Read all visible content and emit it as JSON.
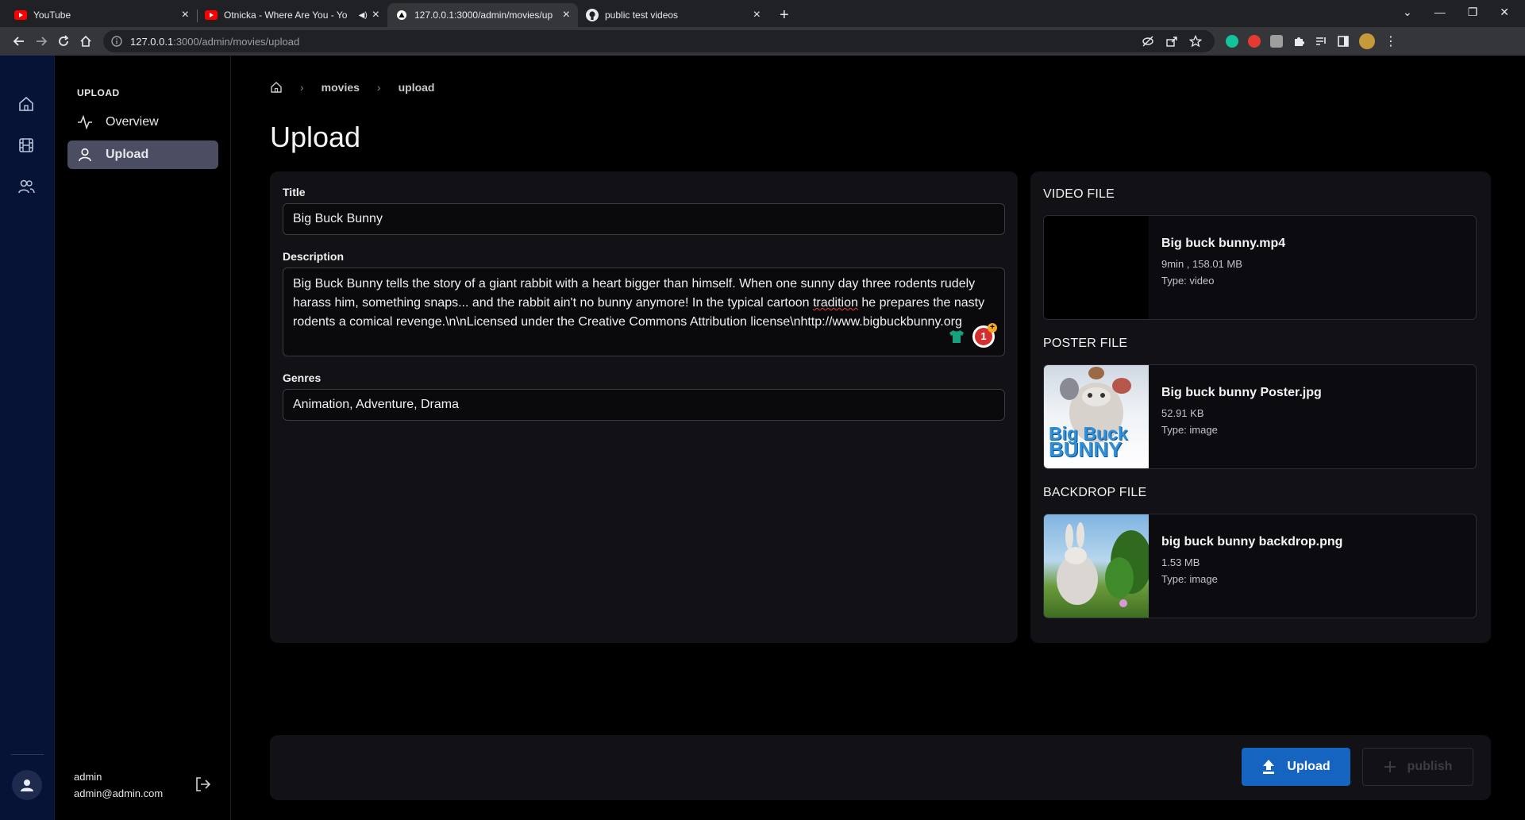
{
  "browser": {
    "tabs": [
      {
        "title": "YouTube",
        "favicon": "youtube-icon",
        "active": false
      },
      {
        "title": "Otnicka - Where Are You - Yo",
        "favicon": "youtube-icon",
        "active": false
      },
      {
        "title": "127.0.0.1:3000/admin/movies/up",
        "favicon": "vercel-triangle-icon",
        "active": true
      },
      {
        "title": "public test videos",
        "favicon": "github-icon",
        "active": false
      }
    ],
    "url_host": "127.0.0.1",
    "url_path": ":3000/admin/movies/upload"
  },
  "subnav": {
    "heading": "UPLOAD",
    "items": [
      {
        "label": "Overview",
        "icon": "activity-icon",
        "active": false
      },
      {
        "label": "Upload",
        "icon": "user-icon",
        "active": true
      }
    ]
  },
  "user": {
    "name": "admin",
    "email": "admin@admin.com"
  },
  "breadcrumb": {
    "items": [
      "movies",
      "upload"
    ]
  },
  "page": {
    "title": "Upload"
  },
  "form": {
    "title_label": "Title",
    "title_value": "Big Buck Bunny",
    "description_label": "Description",
    "description_before": "Big Buck Bunny tells the story of a giant rabbit with a heart bigger than himself. When one sunny day three rodents rudely harass him, something snaps... and the rabbit ain't no bunny anymore! In the typical cartoon ",
    "description_flagged": "tradition",
    "description_after": " he prepares the nasty rodents a comical revenge.\\n\\nLicensed under the Creative Commons Attribution license\\nhttp://www.bigbuckbunny.org",
    "grammar_count": "1",
    "genres_label": "Genres",
    "genres_value": "Animation, Adventure, Drama"
  },
  "files": {
    "video": {
      "section": "VIDEO FILE",
      "name": "Big buck bunny.mp4",
      "size": "9min , 158.01 MB",
      "type": "Type: video"
    },
    "poster": {
      "section": "POSTER FILE",
      "name": "Big buck bunny Poster.jpg",
      "size": "52.91 KB",
      "type": "Type: image",
      "thumb_text_1": "Big Buck",
      "thumb_text_2": "BUNNY"
    },
    "backdrop": {
      "section": "BACKDROP FILE",
      "name": "big buck bunny backdrop.png",
      "size": "1.53 MB",
      "type": "Type: image"
    }
  },
  "actions": {
    "upload_label": "Upload",
    "publish_label": "publish"
  },
  "colors": {
    "rail_bg": "#061236",
    "primary": "#1565c0",
    "active_nav": "#4b4d63"
  }
}
